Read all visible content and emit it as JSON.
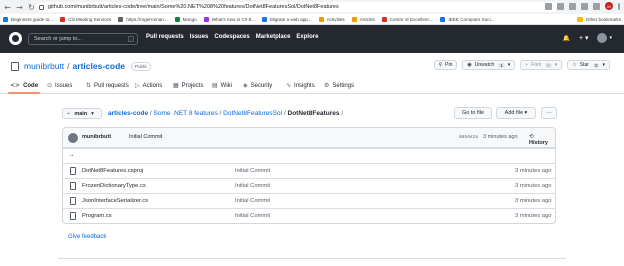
{
  "browser": {
    "back": "←",
    "forward": "→",
    "reload": "↻",
    "url": "github.com/munibrbutt/articles-code/tree/main/Some%20.NET%208%20features/DotNet8FeaturesSol/DotNet8Features",
    "profile_initial": "M",
    "bookmarks": [
      {
        "label": "Beginners guide to...",
        "color": "#1a73e8"
      },
      {
        "label": "Citi Meeting Services",
        "color": "#d93025"
      },
      {
        "label": "https://rogerroman...",
        "color": "#5f6368"
      },
      {
        "label": "Mongo",
        "color": "#188038"
      },
      {
        "label": "What's new in C# 8...",
        "color": "#9334e6"
      },
      {
        "label": "Migrate a web app...",
        "color": "#1a73e8"
      },
      {
        "label": "Activities",
        "color": "#f29900"
      },
      {
        "label": "Articles",
        "color": "#f29900"
      },
      {
        "label": "Centre of Excellenc...",
        "color": "#d93025"
      },
      {
        "label": "IEEE Computer Soci...",
        "color": "#1a73e8"
      }
    ],
    "other_bookmarks": "Other bookmarks"
  },
  "gh_header": {
    "search_placeholder": "Search or jump to...",
    "search_key": "/",
    "nav": [
      "Pull requests",
      "Issues",
      "Codespaces",
      "Marketplace",
      "Explore"
    ],
    "bell": "🔔",
    "plus": "+ ▾",
    "avatar_caret": "▾"
  },
  "repo": {
    "owner": "munibrbutt",
    "separator": "/",
    "name": "articles-code",
    "visibility": "Public",
    "pin": "Pin",
    "unwatch": "Unwatch",
    "unwatch_count": "1",
    "fork": "Fork",
    "fork_count": "0",
    "star": "Star",
    "star_count": "0"
  },
  "tabs": [
    {
      "icon": "<>",
      "label": "Code"
    },
    {
      "icon": "⊙",
      "label": "Issues"
    },
    {
      "icon": "⇅",
      "label": "Pull requests"
    },
    {
      "icon": "▷",
      "label": "Actions"
    },
    {
      "icon": "▦",
      "label": "Projects"
    },
    {
      "icon": "▤",
      "label": "Wiki"
    },
    {
      "icon": "◈",
      "label": "Security"
    },
    {
      "icon": "∿",
      "label": "Insights"
    },
    {
      "icon": "⚙",
      "label": "Settings"
    }
  ],
  "branch": {
    "label": "main",
    "icon": "⑂",
    "caret": "▾"
  },
  "breadcrumb": {
    "root": "articles-code",
    "parts": [
      "Some .NET 8 features",
      "DotNet8FeaturesSol"
    ],
    "current": "DotNet8Features",
    "sep": "/"
  },
  "buttons": {
    "goto": "Go to file",
    "add_file": "Add file ▾",
    "more": "···"
  },
  "commit": {
    "user": "munibrbutt",
    "message": "Initial Commit",
    "hash": "6654e2a",
    "ago": "3 minutes ago",
    "history": "History",
    "history_icon": "⟲"
  },
  "files": [
    {
      "name": "..",
      "message": "",
      "age": ""
    },
    {
      "name": "DotNet8Features.csproj",
      "message": "Initial Commit",
      "age": "3 minutes ago"
    },
    {
      "name": "FrozenDictionaryType.cs",
      "message": "Initial Commit",
      "age": "3 minutes ago"
    },
    {
      "name": "JsonInterfaceSerializer.cs",
      "message": "Initial Commit",
      "age": "3 minutes ago"
    },
    {
      "name": "Program.cs",
      "message": "Initial Commit",
      "age": "3 minutes ago"
    }
  ],
  "feedback": "Give feedback"
}
